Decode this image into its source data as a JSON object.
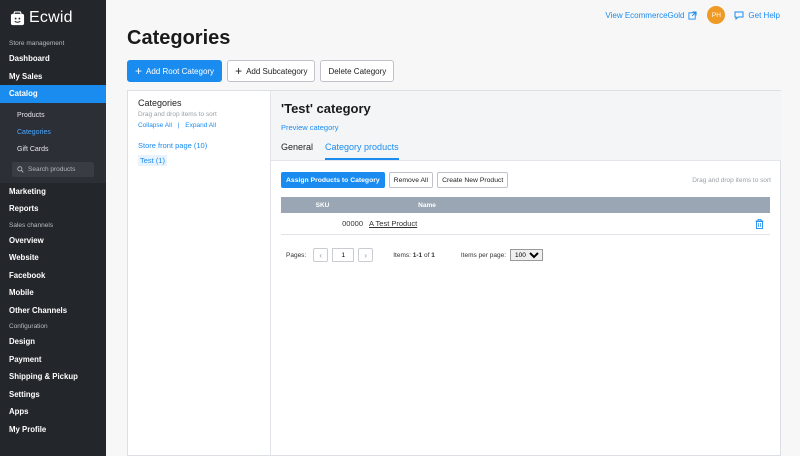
{
  "app": {
    "name": "Ecwid"
  },
  "sidebar": {
    "sections": {
      "store_management": "Store management",
      "sales_channels": "Sales channels",
      "configuration": "Configuration"
    },
    "items": {
      "dashboard": "Dashboard",
      "my_sales": "My Sales",
      "catalog": "Catalog",
      "marketing": "Marketing",
      "reports": "Reports",
      "overview": "Overview",
      "website": "Website",
      "facebook": "Facebook",
      "mobile": "Mobile",
      "other_channels": "Other Channels",
      "design": "Design",
      "payment": "Payment",
      "shipping": "Shipping & Pickup",
      "settings": "Settings",
      "apps": "Apps",
      "my_profile": "My Profile"
    },
    "catalog_sub": {
      "products": "Products",
      "categories": "Categories",
      "gift_cards": "Gift Cards",
      "search_placeholder": "Search products"
    }
  },
  "topbar": {
    "store_link": "View EcommerceGold",
    "avatar_initials": "PH",
    "help": "Get Help"
  },
  "page": {
    "title": "Categories",
    "actions": {
      "add_root": "Add Root Category",
      "add_sub": "Add Subcategory",
      "delete": "Delete Category"
    }
  },
  "tree": {
    "title": "Categories",
    "hint": "Drag and drop items to sort",
    "collapse_all": "Collapse All",
    "separator": "|",
    "expand_all": "Expand All",
    "root": "Store front page (10)",
    "child": "Test (1)"
  },
  "details": {
    "title": "'Test' category",
    "preview": "Preview category",
    "tabs": {
      "general": "General",
      "products": "Category products"
    },
    "toolbar": {
      "assign": "Assign Products to Category",
      "remove_all": "Remove All",
      "create": "Create New Product",
      "drag_hint": "Drag and drop items to sort"
    },
    "table": {
      "headers": {
        "sku": "SKU",
        "name": "Name"
      },
      "rows": [
        {
          "sku": "00000",
          "name": "A Test Product"
        }
      ]
    },
    "pager": {
      "pages_label": "Pages:",
      "page": "1",
      "items_prefix": "Items:",
      "items_range": "1-1",
      "items_of": "of",
      "items_total": "1",
      "per_page_label": "Items per page:",
      "per_page_value": "100"
    }
  },
  "colors": {
    "accent": "#1a8cf0",
    "sidebar": "#23262b",
    "avatar": "#f09a26"
  }
}
